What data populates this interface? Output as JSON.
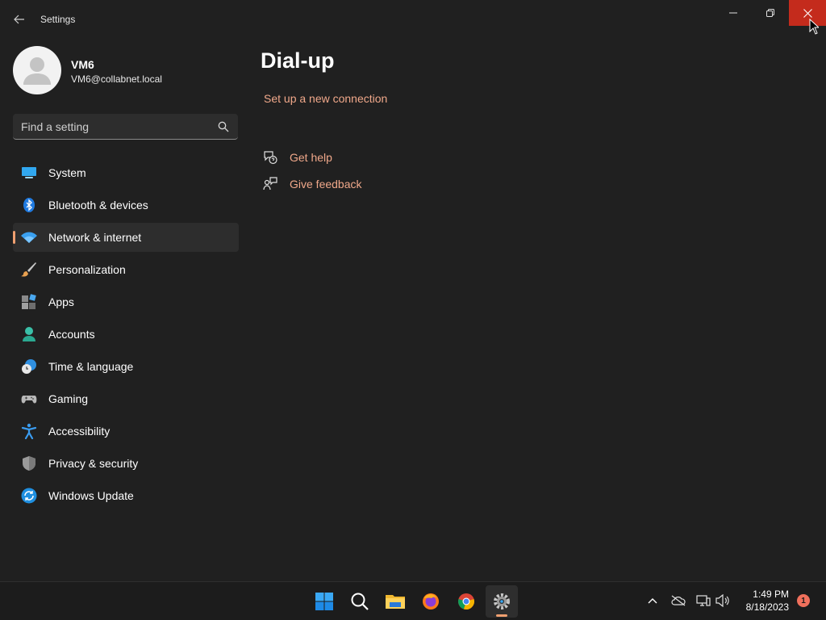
{
  "window": {
    "title": "Settings"
  },
  "profile": {
    "name": "VM6",
    "email": "VM6@collabnet.local"
  },
  "search": {
    "placeholder": "Find a setting"
  },
  "nav": {
    "items": [
      {
        "label": "System",
        "icon": "system-icon"
      },
      {
        "label": "Bluetooth & devices",
        "icon": "bluetooth-icon"
      },
      {
        "label": "Network & internet",
        "icon": "wifi-icon",
        "active": true
      },
      {
        "label": "Personalization",
        "icon": "brush-icon"
      },
      {
        "label": "Apps",
        "icon": "apps-icon"
      },
      {
        "label": "Accounts",
        "icon": "accounts-icon"
      },
      {
        "label": "Time & language",
        "icon": "clock-globe-icon"
      },
      {
        "label": "Gaming",
        "icon": "gamepad-icon"
      },
      {
        "label": "Accessibility",
        "icon": "accessibility-icon"
      },
      {
        "label": "Privacy & security",
        "icon": "shield-icon"
      },
      {
        "label": "Windows Update",
        "icon": "update-icon"
      }
    ]
  },
  "main": {
    "title": "Dial-up",
    "setup_link": "Set up a new connection",
    "get_help": "Get help",
    "give_feedback": "Give feedback"
  },
  "taskbar": {
    "time": "1:49 PM",
    "date": "8/18/2023",
    "notification_count": "1"
  },
  "colors": {
    "background": "#202020",
    "accent": "#f0a070",
    "link": "#f0a88a",
    "close_button": "#c42b1c"
  }
}
